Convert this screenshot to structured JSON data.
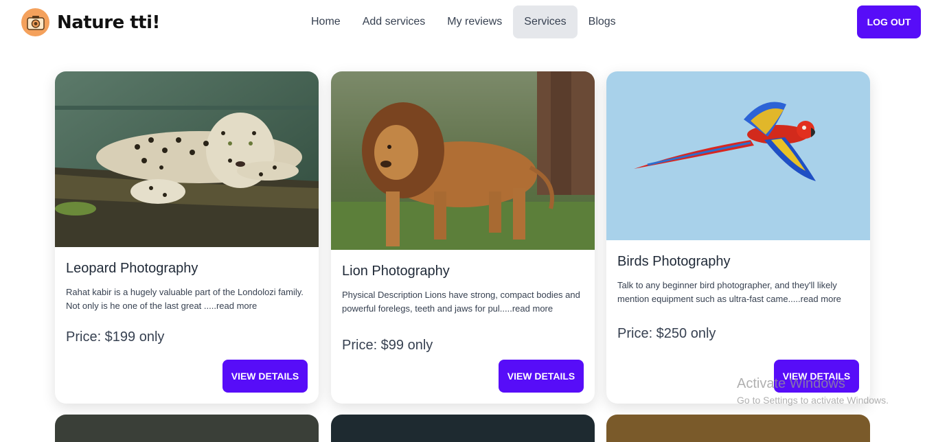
{
  "brand": {
    "name": "Nature tti!",
    "logo_icon": "camera-icon"
  },
  "nav": {
    "items": [
      {
        "label": "Home",
        "active": false
      },
      {
        "label": "Add services",
        "active": false
      },
      {
        "label": "My reviews",
        "active": false
      },
      {
        "label": "Services",
        "active": true
      },
      {
        "label": "Blogs",
        "active": false
      }
    ],
    "logout_label": "LOG OUT"
  },
  "services": [
    {
      "title": "Leopard Photography",
      "description": "Rahat kabir is a hugely valuable part of the Londolozi family. Not only is he one of the last great .....read more",
      "price": "Price: $199 only",
      "button_label": "VIEW DETAILS",
      "image": "leopard-on-log"
    },
    {
      "title": "Lion Photography",
      "description": "Physical Description Lions have strong, compact bodies and powerful forelegs, teeth and jaws for pul.....read more",
      "price": "Price: $99 only",
      "button_label": "VIEW DETAILS",
      "image": "lion-walking"
    },
    {
      "title": "Birds Photography",
      "description": "Talk to any beginner bird photographer, and they'll likely mention equipment such as ultra-fast came.....read more",
      "price": "Price: $250 only",
      "button_label": "VIEW DETAILS",
      "image": "macaw-flying"
    }
  ],
  "watermark": {
    "title": "Activate Windows",
    "subtitle": "Go to Settings to activate Windows."
  },
  "colors": {
    "primary": "#570df8",
    "logo_bg": "#f4a15c",
    "active_nav_bg": "#e5e7eb"
  }
}
